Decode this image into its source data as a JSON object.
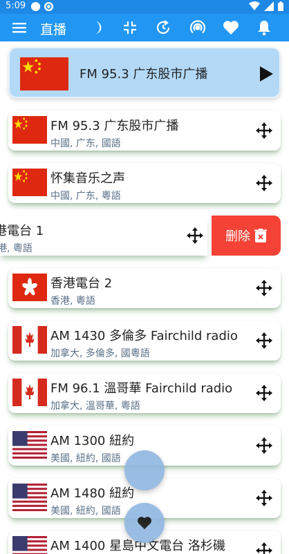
{
  "status": {
    "time": "5:09"
  },
  "app_bar": {
    "title": "直播",
    "icons": [
      "menu-icon",
      "moon-icon",
      "collapse-icon",
      "refresh-timer-icon",
      "broadcast-icon",
      "heart-icon",
      "bell-icon"
    ]
  },
  "now_playing": {
    "title": "FM 95.3 广东股市广播",
    "flag": "China"
  },
  "stations": [
    {
      "name": "FM 95.3 广东股市广播",
      "sub": "中國, 广东, 國語",
      "flag": "China"
    },
    {
      "name": "怀集音乐之声",
      "sub": "中國, 广东, 粵語",
      "flag": "China"
    },
    {
      "name": "香港電台 2",
      "sub": "香港, 粵語",
      "flag": "Hong Kong"
    },
    {
      "name": "AM 1430 多倫多 Fairchild radio",
      "sub": "加拿大, 多倫多, 國粵語",
      "flag": "Canada"
    },
    {
      "name": "FM 96.1 溫哥華 Fairchild radio",
      "sub": "加拿大, 溫哥華, 粵語",
      "flag": "Canada"
    },
    {
      "name": "AM 1300 紐約",
      "sub": "美國, 紐約, 國語",
      "flag": "USA"
    },
    {
      "name": "AM 1480 紐約",
      "sub": "美國, 紐約, 國語",
      "flag": "USA"
    },
    {
      "name": "AM 1400 星島中文電台 洛杉磯",
      "sub": "",
      "flag": "USA"
    }
  ],
  "swiped_item": {
    "name": "港電台 1",
    "sub": "港, 粵語",
    "delete_label": "删除"
  },
  "colors": {
    "app_bar": "#2196f3",
    "status_bar": "#1e88e5",
    "now_playing_bg": "#b3d9f7",
    "delete": "#f44336"
  }
}
